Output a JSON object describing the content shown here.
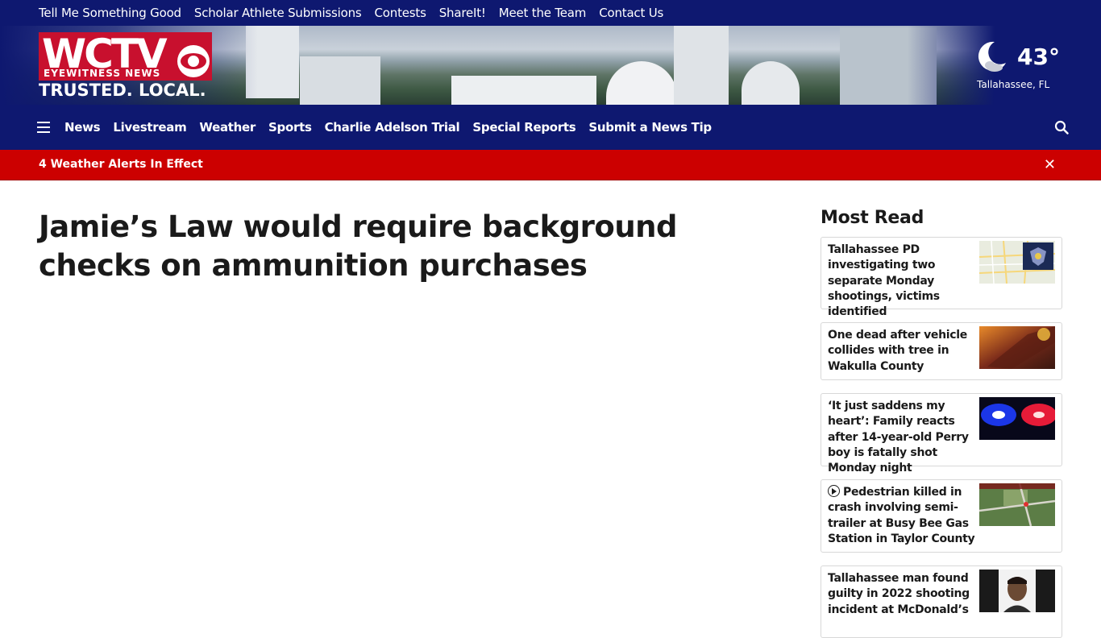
{
  "top_links": [
    "Tell Me Something Good",
    "Scholar Athlete Submissions",
    "Contests",
    "ShareIt!",
    "Meet the Team",
    "Contact Us"
  ],
  "logo": {
    "letters": "WCTV",
    "sub": "EYEWITNESS NEWS",
    "tagline": "TRUSTED. LOCAL."
  },
  "weather": {
    "temp": "43°",
    "location": "Tallahassee, FL",
    "icon": "moon-cloud-icon"
  },
  "nav": {
    "items": [
      "News",
      "Livestream",
      "Weather",
      "Sports",
      "Charlie Adelson Trial",
      "Special Reports",
      "Submit a News Tip"
    ],
    "menu_icon": "hamburger-icon",
    "search_icon": "search-icon"
  },
  "alert": {
    "text": "4 Weather Alerts In Effect",
    "close": "✕"
  },
  "article": {
    "headline": "Jamie’s Law would require background checks on ammunition purchases"
  },
  "sidebar": {
    "title": "Most Read",
    "items": [
      {
        "title": "Tallahassee PD investigating two separate Monday shootings, victims identified",
        "video": false
      },
      {
        "title": "One dead after vehicle collides with tree in Wakulla County",
        "video": false
      },
      {
        "title": "‘It just saddens my heart’: Family reacts after 14-year-old Perry boy is fatally shot Monday night",
        "video": false
      },
      {
        "title": "Pedestrian killed in crash involving semi-trailer at Busy Bee Gas Station in Taylor County",
        "video": true
      },
      {
        "title": "Tallahassee man found guilty in 2022 shooting incident at McDonald’s",
        "video": false
      }
    ]
  },
  "colors": {
    "nav_bg": "#0e1870",
    "alert_bg": "#cc0000",
    "brand_red": "#c8102e",
    "text": "#1a1a1a"
  }
}
